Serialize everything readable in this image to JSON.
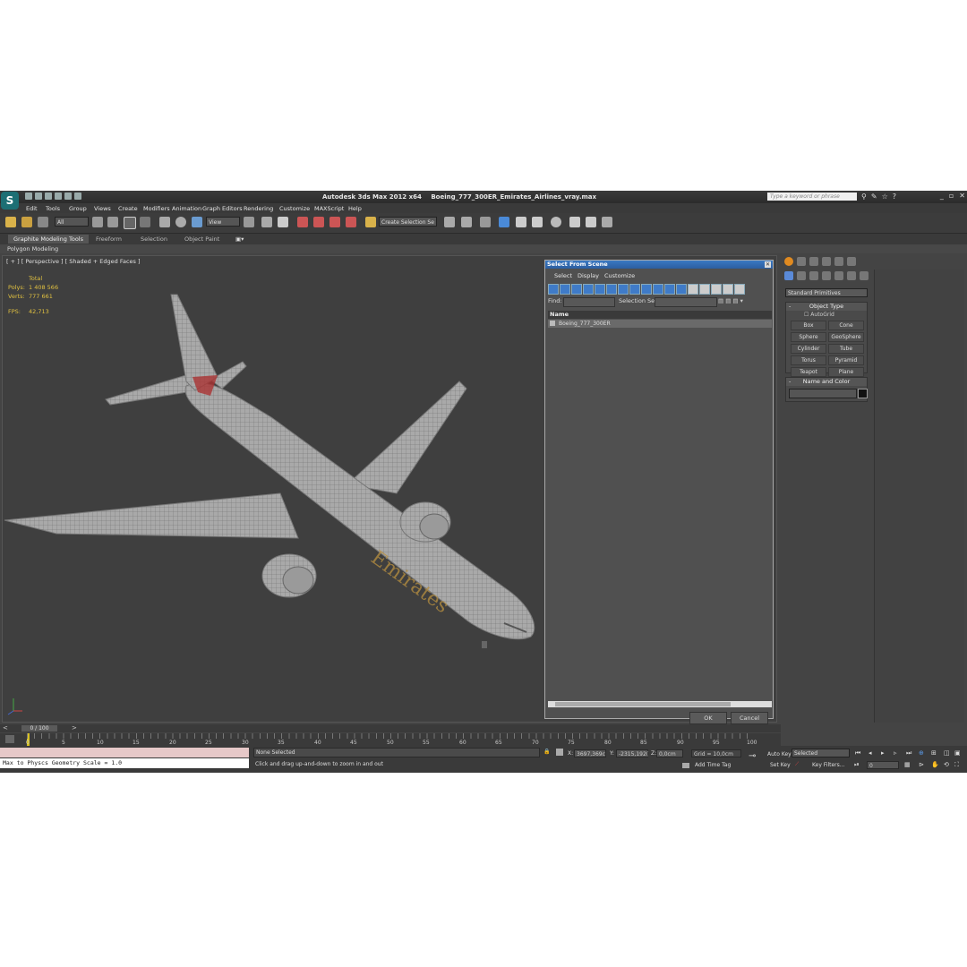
{
  "window": {
    "app_title": "Autodesk 3ds Max  2012 x64",
    "file_title": "Boeing_777_300ER_Emirates_Airlines_vray.max",
    "search_placeholder": "Type a keyword or phrase"
  },
  "menu": [
    "Edit",
    "Tools",
    "Group",
    "Views",
    "Create",
    "Modifiers",
    "Animation",
    "Graph Editors",
    "Rendering",
    "Customize",
    "MAXScript",
    "Help"
  ],
  "toolbar": {
    "filter_value": "All",
    "refcoord_value": "View",
    "selection_set_value": "Create Selection Se"
  },
  "ribbon": {
    "tabs": [
      "Graphite Modeling Tools",
      "Freeform",
      "Selection",
      "Object Paint"
    ],
    "sub_label": "Polygon Modeling"
  },
  "viewport": {
    "label": "[ + ] [ Perspective ] [ Shaded + Edged Faces ]",
    "stats": {
      "total_label": "Total",
      "polys_label": "Polys:",
      "polys_value": "1 408 566",
      "verts_label": "Verts:",
      "verts_value": "777 661",
      "fps_label": "FPS:",
      "fps_value": "42,713"
    },
    "livery_text": "Emirates"
  },
  "dialog": {
    "title": "Select From Scene",
    "menus": [
      "Select",
      "Display",
      "Customize"
    ],
    "find_label": "Find:",
    "selection_set_label": "Selection Set:",
    "column_name": "Name",
    "rows": [
      "Boeing_777_300ER"
    ],
    "ok_label": "OK",
    "cancel_label": "Cancel"
  },
  "command_panel": {
    "category": "Standard Primitives",
    "object_type_title": "Object Type",
    "autogrid_label": "AutoGrid",
    "primitives": [
      "Box",
      "Cone",
      "Sphere",
      "GeoSphere",
      "Cylinder",
      "Tube",
      "Torus",
      "Pyramid",
      "Teapot",
      "Plane"
    ],
    "name_color_title": "Name and Color"
  },
  "timeline": {
    "frame_readout": "0 / 100",
    "ticks": [
      "0",
      "5",
      "10",
      "15",
      "20",
      "25",
      "30",
      "35",
      "40",
      "45",
      "50",
      "55",
      "60",
      "65",
      "70",
      "75",
      "80",
      "85",
      "90",
      "95",
      "100"
    ]
  },
  "status": {
    "maxscript_output": "Max to Physcs Geometry Scale = 1.0",
    "selection_status": "None Selected",
    "prompt": "Click and drag up-and-down to zoom in and out",
    "x_label": "X:",
    "x_value": "3697,369c",
    "y_label": "Y:",
    "y_value": "-2315,192(",
    "z_label": "Z:",
    "z_value": "0,0cm",
    "grid": "Grid = 10,0cm",
    "add_time_tag": "Add Time Tag",
    "auto_key": "Auto Key",
    "set_key": "Set Key",
    "key_mode_value": "Selected",
    "key_filters": "Key Filters...",
    "frame_value": "0"
  },
  "colors": {
    "accent_blue": "#3a78c2",
    "stats_yellow": "#e0c040",
    "viewport_bg": "#3f3f3f"
  }
}
